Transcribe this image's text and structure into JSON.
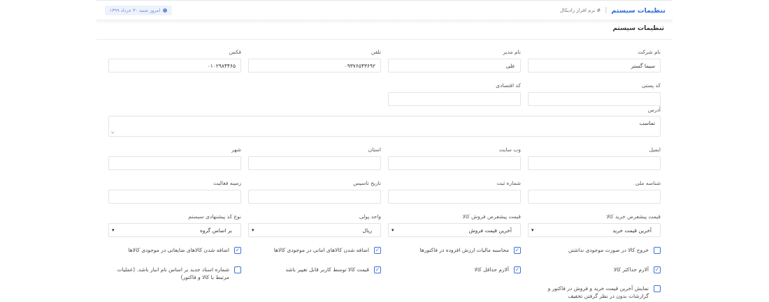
{
  "header": {
    "title": "تنظیمات سیستم",
    "subtitle": "# نرم افزار رادیکال",
    "date_badge": "امروز شنبه ۳۰ خرداد ۱۳۹۹"
  },
  "section": {
    "title": "تنظیمات سیستم"
  },
  "fields": {
    "company_name": {
      "label": "نام شرکت",
      "value": "سیما گستر"
    },
    "manager_name": {
      "label": "نام مدیر",
      "value": "علی"
    },
    "phone": {
      "label": "تلفن",
      "value": "۰۹۳۷۶۵۴۳۶۹۲"
    },
    "fax": {
      "label": "فکس",
      "value": "۰۱۰۲۹۸۴۴۶۵"
    },
    "postal_code": {
      "label": "کد پستی",
      "value": ""
    },
    "economic_code": {
      "label": "کد اقتصادی",
      "value": ""
    },
    "address": {
      "label": "آدرس",
      "value": "تماسب"
    },
    "email": {
      "label": "ایمیل",
      "value": ""
    },
    "website": {
      "label": "وب سایت",
      "value": ""
    },
    "province": {
      "label": "استان",
      "value": ""
    },
    "city": {
      "label": "شهر",
      "value": ""
    },
    "national_id": {
      "label": "شناسه ملی",
      "value": ""
    },
    "registration_no": {
      "label": "شماره ثبت",
      "value": ""
    },
    "founding_date": {
      "label": "تاریخ تاسیس",
      "value": ""
    },
    "activity_field": {
      "label": "زمینه فعالیت",
      "value": ""
    }
  },
  "selects": {
    "default_buy_price": {
      "label": "قیمت پیشفرض خرید کالا",
      "value": "آخرین قیمت خرید"
    },
    "default_sell_price": {
      "label": "قیمت پیشفرض فروش کالا",
      "value": "آخرین قیمت فروش"
    },
    "currency_unit": {
      "label": "واحد پولی",
      "value": "ریال"
    },
    "code_suggestion": {
      "label": "نوع کد پیشنهادی سیستم",
      "value": "بر اساس گروه"
    }
  },
  "checkboxes": [
    {
      "label": "خروج کالا در صورت موجودی نداشتن",
      "checked": false
    },
    {
      "label": "محاسبه مالیات ارزش افزوده در فاکتورها",
      "checked": true
    },
    {
      "label": "اضافه شدن کالاهای امانی در موجودی کالاها",
      "checked": true
    },
    {
      "label": "اضافه شدن کالاهای ضایعاتی در موجودی کالاها",
      "checked": true
    },
    {
      "label": "آلارم حداکثر کالا",
      "checked": true
    },
    {
      "label": "آلارم حداقل کالا",
      "checked": true
    },
    {
      "label": "قیمت کالا توسط کاربر قابل تغییر باشد",
      "checked": true
    },
    {
      "label": "شماره اسناد جدید بر اساس نام انبار باشد. (عملیات مرتبط با کالا و فاکتور)",
      "checked": false
    },
    {
      "label": "نمایش آخرین قیمت خرید و فروش در فاکتور و گزارشات بدون در نظر گرفتن تخفیف",
      "checked": false
    }
  ],
  "icons": {
    "check": "check-icon",
    "caret": "chevron-down-icon",
    "resize": "resize-handle-icon"
  },
  "colors": {
    "accent": "#2f6bd8",
    "checkbox": "#3d72d8",
    "border": "#e1e4ea"
  }
}
